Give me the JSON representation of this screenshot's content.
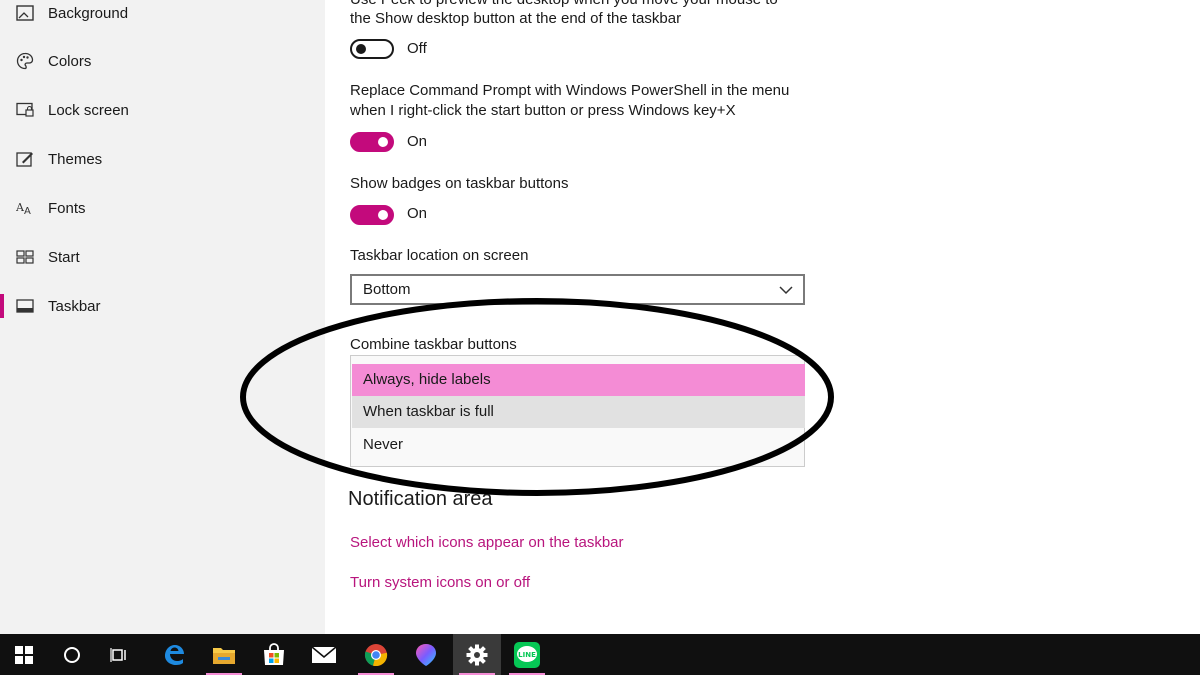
{
  "sidebar": {
    "items": [
      {
        "label": "Background",
        "icon": "image-icon"
      },
      {
        "label": "Colors",
        "icon": "palette-icon"
      },
      {
        "label": "Lock screen",
        "icon": "lock-screen-icon"
      },
      {
        "label": "Themes",
        "icon": "themes-brush-icon"
      },
      {
        "label": "Fonts",
        "icon": "fonts-icon"
      },
      {
        "label": "Start",
        "icon": "start-grid-icon"
      },
      {
        "label": "Taskbar",
        "icon": "taskbar-icon",
        "active": true
      }
    ]
  },
  "settings": {
    "peek": {
      "label_line1": "Use Peek to preview the desktop when you move your mouse to",
      "label_line2": "the Show desktop button at the end of the taskbar",
      "state": "Off"
    },
    "powershell": {
      "label_line1": "Replace Command Prompt with Windows PowerShell in the menu",
      "label_line2": "when I right-click the start button or press Windows key+X",
      "state": "On"
    },
    "badges": {
      "label": "Show badges on taskbar buttons",
      "state": "On"
    },
    "location": {
      "label": "Taskbar location on screen",
      "value": "Bottom"
    },
    "combine": {
      "label": "Combine taskbar buttons",
      "options": [
        "Always, hide labels",
        "When taskbar is full",
        "Never"
      ],
      "selected": "Always, hide labels"
    }
  },
  "notification_area": {
    "heading": "Notification area",
    "links": [
      "Select which icons appear on the taskbar",
      "Turn system icons on or off"
    ]
  },
  "taskbar": {
    "apps": [
      "windows-start-icon",
      "cortana-circle-icon",
      "task-view-icon",
      "edge-icon",
      "file-explorer-icon",
      "store-icon",
      "mail-icon",
      "chrome-icon",
      "paint-3d-icon",
      "settings-gear-icon",
      "line-app-icon"
    ],
    "line_app_text": "LINE"
  },
  "colors": {
    "accent": "#c30a7c",
    "selected_option": "#f48cd5",
    "link": "#b8157d"
  }
}
